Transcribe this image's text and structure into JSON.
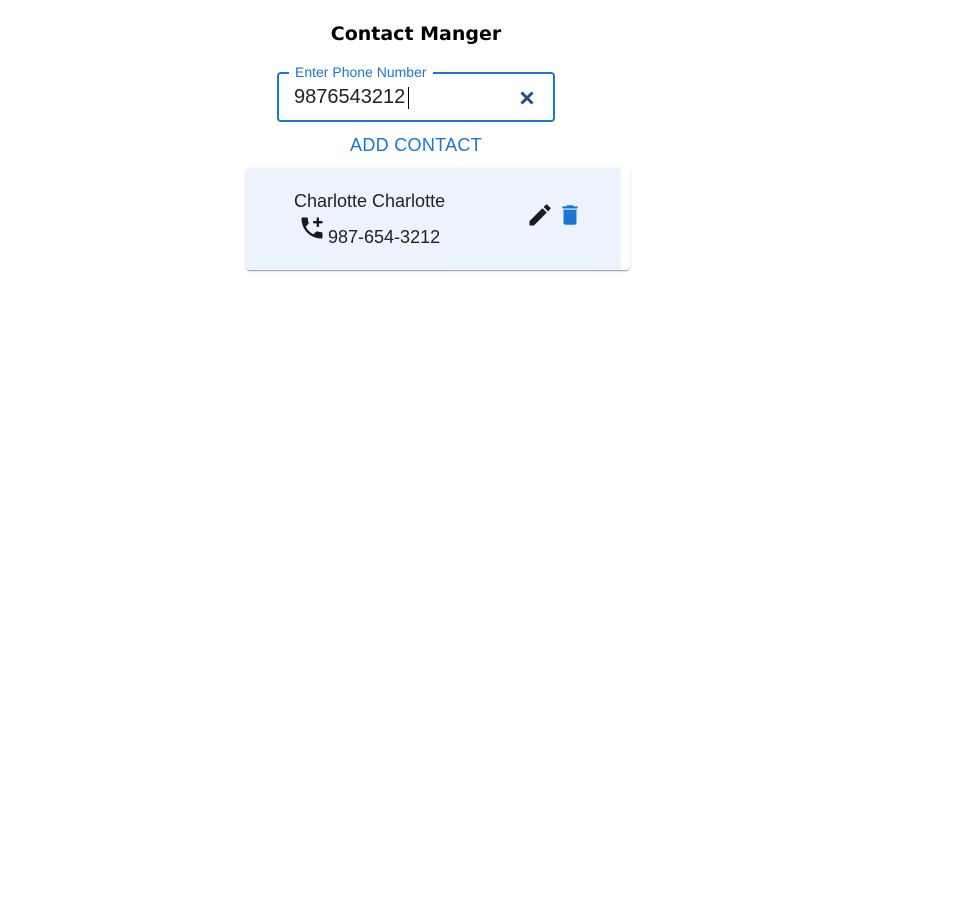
{
  "header": {
    "title": "Contact Manger"
  },
  "phone_field": {
    "label": "Enter Phone Number",
    "value": "9876543212",
    "clear_icon": "close-icon"
  },
  "actions": {
    "add_label": "ADD CONTACT"
  },
  "contacts": [
    {
      "name": "Charlotte Charlotte",
      "phone": "987-654-3212",
      "phone_icon": "add-call-icon",
      "edit_icon": "pencil-icon",
      "delete_icon": "trash-icon"
    }
  ],
  "colors": {
    "accent": "#1976d2",
    "card_background": "#ecf3fc",
    "clear_icon": "#1f4e89",
    "text": "#222222"
  }
}
